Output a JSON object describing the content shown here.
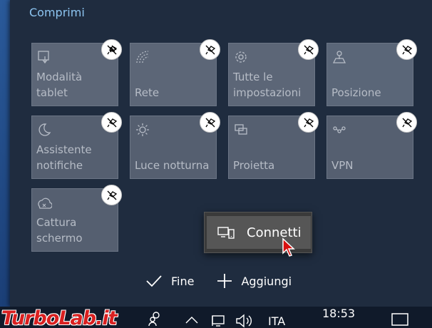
{
  "action_center": {
    "collapse_label": "Comprimi",
    "tiles": [
      {
        "label": "Modalità tablet",
        "icon": "tablet-mode-icon"
      },
      {
        "label": "Rete",
        "icon": "network-icon"
      },
      {
        "label": "Tutte le\nimpostazioni",
        "icon": "gear-icon"
      },
      {
        "label": "Posizione",
        "icon": "location-icon"
      },
      {
        "label": "Assistente\nnotifiche",
        "icon": "moon-icon"
      },
      {
        "label": "Luce notturna",
        "icon": "brightness-icon"
      },
      {
        "label": "Proietta",
        "icon": "project-icon"
      },
      {
        "label": "VPN",
        "icon": "vpn-icon"
      },
      {
        "label": "Cattura\nschermo",
        "icon": "snip-icon"
      }
    ],
    "context_menu": {
      "item_label": "Connetti"
    },
    "done_label": "Fine",
    "add_label": "Aggiungi"
  },
  "watermark": {
    "text": "TurboLab.it"
  },
  "taskbar": {
    "language": "ITA",
    "time": "18:53"
  }
}
